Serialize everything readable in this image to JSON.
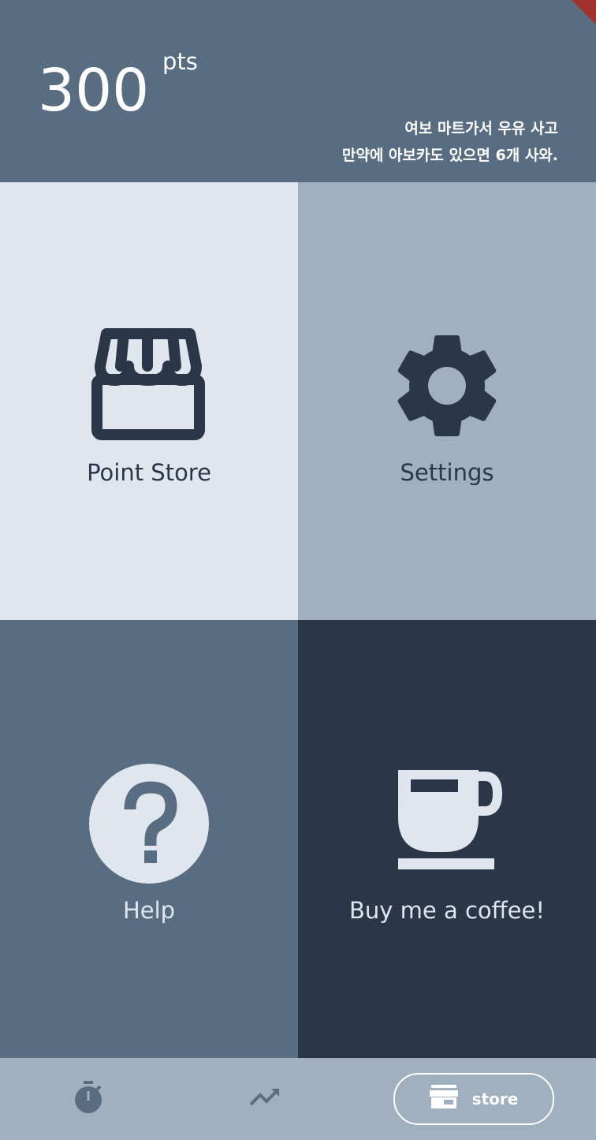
{
  "header": {
    "points_value": "300",
    "points_unit": "pts",
    "quote_line1": "여보 마트가서 우유 사고",
    "quote_line2": "만약에 아보카도 있으면 6개 사와."
  },
  "tiles": [
    {
      "label": "Point Store",
      "icon": "storefront-icon"
    },
    {
      "label": "Settings",
      "icon": "gear-icon"
    },
    {
      "label": "Help",
      "icon": "help-circle-icon"
    },
    {
      "label": "Buy me a coffee!",
      "icon": "coffee-cup-icon"
    }
  ],
  "bottom_nav": {
    "items": [
      {
        "icon": "stopwatch-icon"
      },
      {
        "icon": "trending-up-icon"
      },
      {
        "icon": "storefront-icon",
        "label": "store",
        "selected": true
      }
    ]
  },
  "colors": {
    "header_bg": "#596d82",
    "tile_light": "#e0e6ee",
    "tile_mid": "#a0b0bf",
    "tile_dark": "#2b3649",
    "accent_text": "#ffffff"
  }
}
